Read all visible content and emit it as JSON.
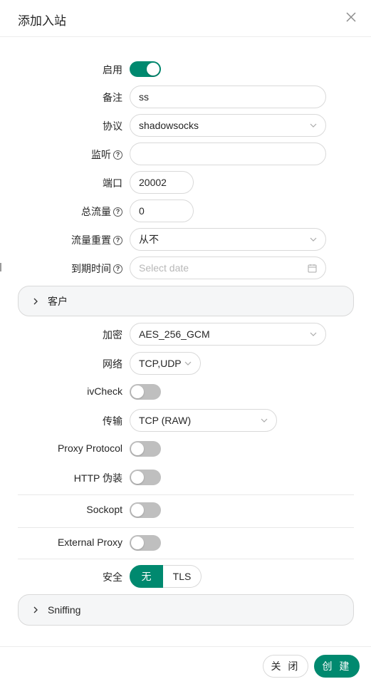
{
  "modal": {
    "title": "添加入站"
  },
  "form": {
    "enable": {
      "label": "启用",
      "on": true
    },
    "remark": {
      "label": "备注",
      "value": "ss"
    },
    "protocol": {
      "label": "协议",
      "value": "shadowsocks"
    },
    "listen": {
      "label": "监听",
      "value": ""
    },
    "port": {
      "label": "端口",
      "value": "20002"
    },
    "total_traffic": {
      "label": "总流量",
      "value": "0"
    },
    "traffic_reset": {
      "label": "流量重置",
      "value": "从不"
    },
    "expiry": {
      "label": "到期时间",
      "placeholder": "Select date"
    },
    "clients": {
      "title": "客户"
    },
    "encryption": {
      "label": "加密",
      "value": "AES_256_GCM"
    },
    "network": {
      "label": "网络",
      "value": "TCP,UDP"
    },
    "ivcheck": {
      "label": "ivCheck",
      "on": false
    },
    "transport": {
      "label": "传输",
      "value": "TCP (RAW)"
    },
    "proxy_protocol": {
      "label": "Proxy Protocol",
      "on": false
    },
    "http_camouflage": {
      "label": "HTTP 伪装",
      "on": false
    },
    "sockopt": {
      "label": "Sockopt",
      "on": false
    },
    "external_proxy": {
      "label": "External Proxy",
      "on": false
    },
    "security": {
      "label": "安全",
      "options": [
        "无",
        "TLS"
      ],
      "selected": "无"
    },
    "sniffing": {
      "title": "Sniffing"
    }
  },
  "footer": {
    "close_label": "关 闭",
    "create_label": "创 建"
  },
  "colors": {
    "accent": "#00896f",
    "switch_off": "#bfbfbf",
    "border": "#d9d9d9",
    "collapse_bg": "#f5f6f7"
  },
  "icons": {
    "close": "close-icon",
    "chevron": "chevron-down-icon",
    "calendar": "calendar-icon",
    "help": "question-circle-icon",
    "expand": "chevron-right-icon"
  }
}
